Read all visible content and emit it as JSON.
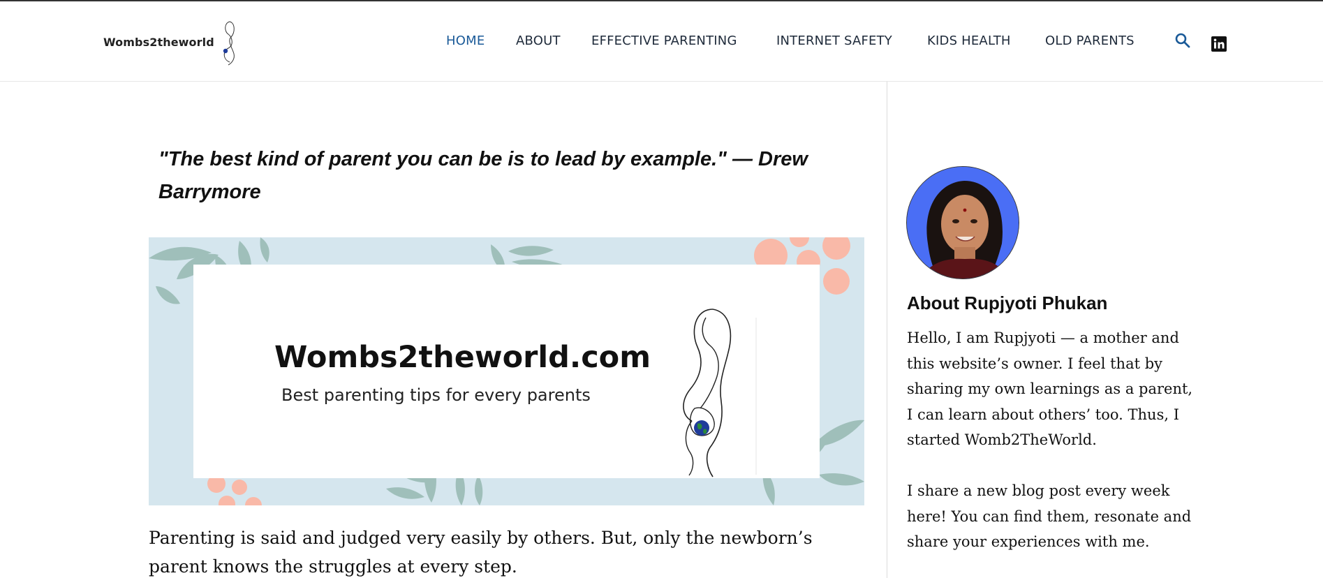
{
  "site": {
    "logo_text": "Wombs2theworld"
  },
  "nav": {
    "items": [
      {
        "label": "HOME",
        "active": true
      },
      {
        "label": "ABOUT",
        "active": false
      },
      {
        "label": "EFFECTIVE PARENTING",
        "active": false
      },
      {
        "label": "INTERNET SAFETY",
        "active": false
      },
      {
        "label": "KIDS HEALTH",
        "active": false
      },
      {
        "label": "OLD PARENTS",
        "active": false
      }
    ],
    "search_icon": "search-icon",
    "social_icon": "linkedin-icon"
  },
  "main": {
    "quote": "\"The best kind of parent you can be is to lead by example.\" — Drew Barrymore",
    "banner": {
      "title": "Wombs2theworld.com",
      "subtitle": "Best parenting tips for every parents"
    },
    "paragraph": "Parenting is said and judged very easily by others. But, only the newborn’s parent knows the struggles at every step."
  },
  "sidebar": {
    "about_title": "About Rupjyoti Phukan",
    "about_paragraphs": [
      "Hello, I am Rupjyoti — a mother and this website’s owner. I feel that by sharing my own learnings as a parent, I can learn about others’ too. Thus, I started Womb2TheWorld.",
      "I share a new blog post every week here! You can find them, resonate and share your experiences with me."
    ]
  },
  "colors": {
    "accent": "#1a5a98",
    "nav_text": "#1e2a3a",
    "banner_bg": "#d5e6ee",
    "avatar_bg": "#4a6ef5",
    "leaf": "#9fbfba",
    "fruit": "#f9b9a8"
  }
}
